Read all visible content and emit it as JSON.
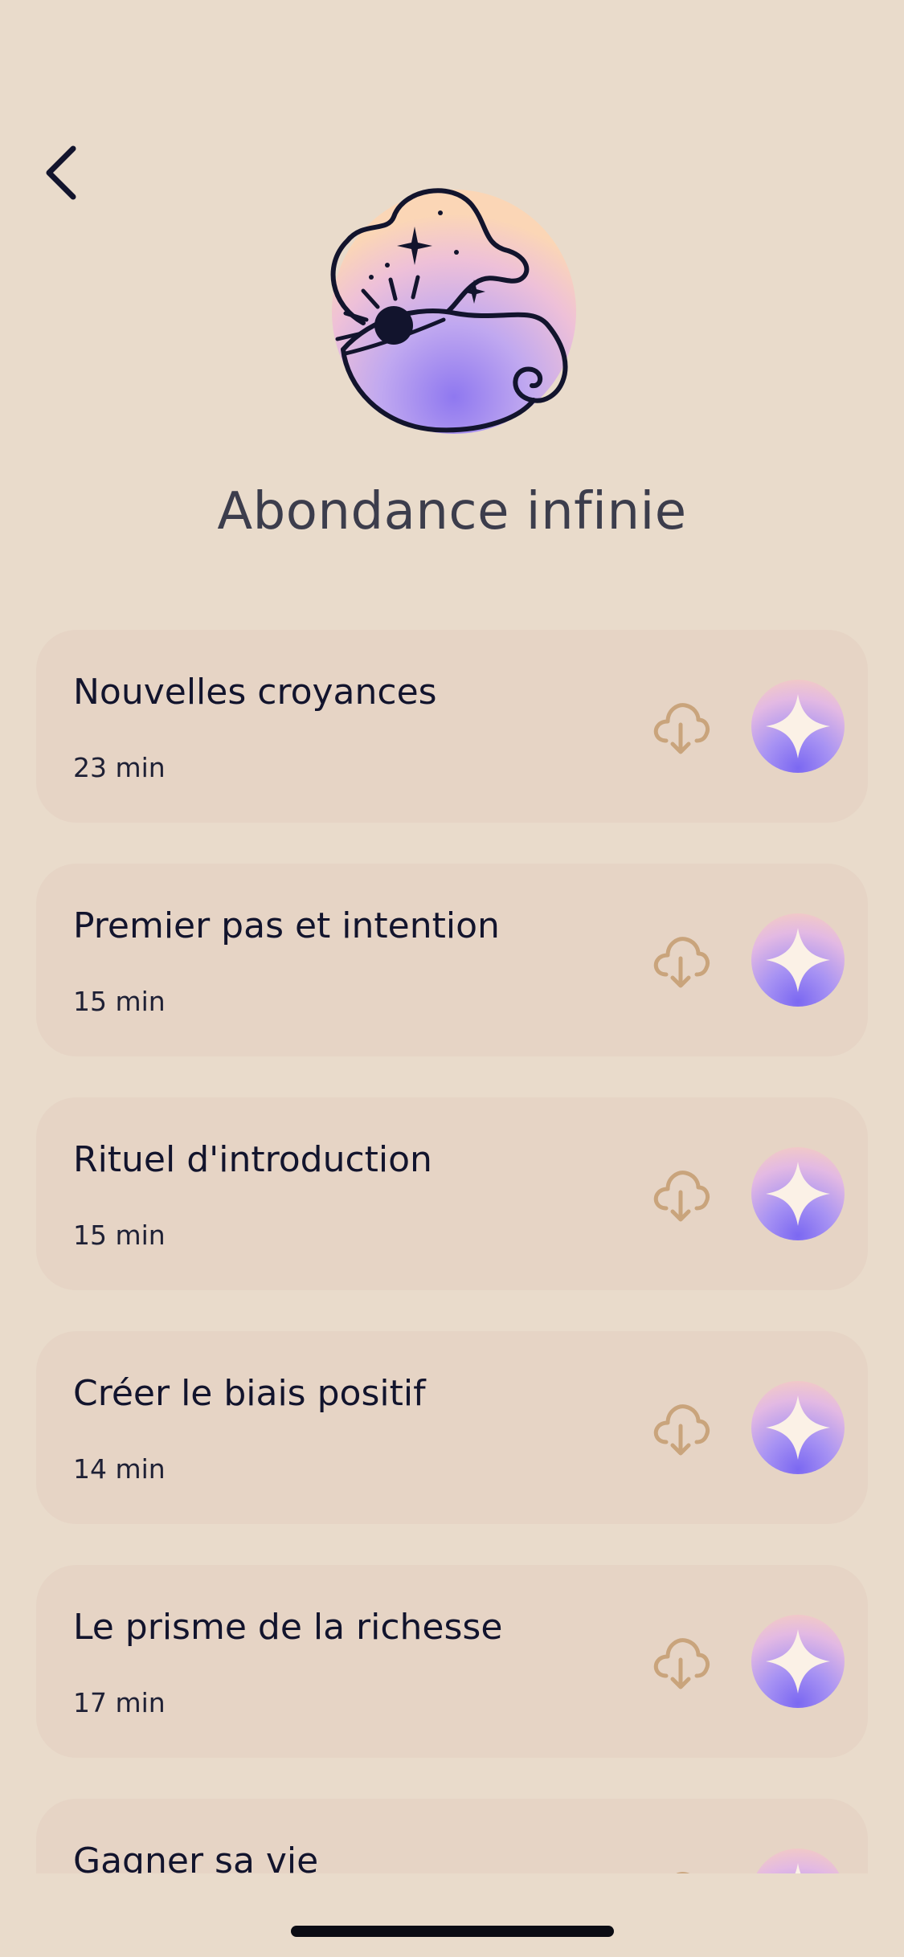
{
  "header": {
    "back_icon": "chevron-left-icon",
    "hero_icon": "mystic-eye-cloud-icon",
    "title": "Abondance infinie"
  },
  "colors": {
    "background": "#e9dbcb",
    "card_background": "#e6d4c5",
    "text_primary": "#12142d",
    "download_icon": "#c9a47c",
    "gradient_top": "#f9d2b8",
    "gradient_bottom": "#7b68f2"
  },
  "sessions": [
    {
      "title": "Nouvelles croyances",
      "duration": "23 min"
    },
    {
      "title": "Premier pas et intention",
      "duration": "15 min"
    },
    {
      "title": "Rituel d'introduction",
      "duration": "15 min"
    },
    {
      "title": "Créer le biais positif",
      "duration": "14 min"
    },
    {
      "title": "Le prisme de la richesse",
      "duration": "17 min"
    },
    {
      "title": "Gagner sa vie",
      "duration": ""
    }
  ],
  "icons": {
    "download": "cloud-download-icon",
    "play": "sparkle-play-icon"
  }
}
